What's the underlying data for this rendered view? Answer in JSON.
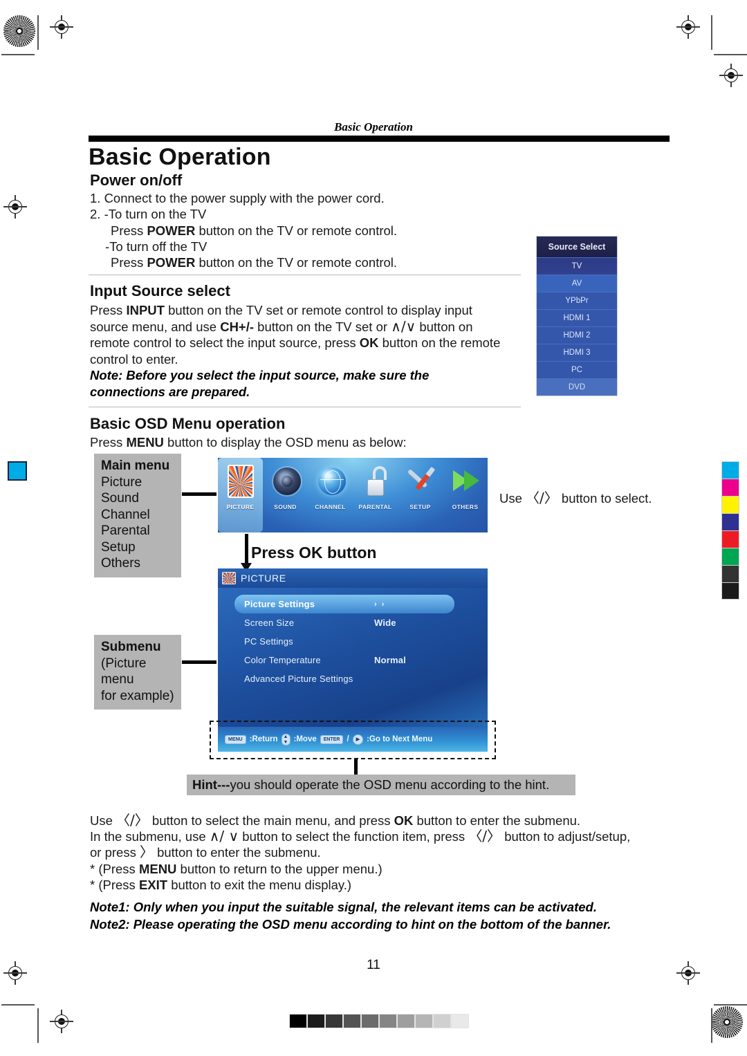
{
  "document": {
    "running_head": "Basic Operation",
    "chapter_title": "Basic Operation",
    "page_number": "11"
  },
  "power_section": {
    "heading": "Power on/off",
    "line1": "1. Connect to the power supply with the power cord.",
    "line2": "2. -To turn on the TV",
    "line3_pre": "Press ",
    "line3_bold": "POWER",
    "line3_post": " button on the TV or remote control.",
    "line4": "-To turn off the TV",
    "line5_pre": "Press ",
    "line5_bold": "POWER",
    "line5_post": " button on the TV or remote control."
  },
  "input_section": {
    "heading": "Input Source select",
    "p1_a": "Press ",
    "p1_b": "INPUT",
    "p1_c": " button on the TV set or remote control to display input source menu, and use ",
    "p1_d": "CH+/-",
    "p1_e": " button on the TV set or ",
    "p1_glyph": "∧/∨",
    "p1_f": " button on remote control to select the input source, press ",
    "p1_g": "OK",
    "p1_h": " button on the remote control to enter.",
    "note": "Note: Before you select the input source, make sure the connections are prepared."
  },
  "source_select": {
    "title": "Source Select",
    "items": [
      "TV",
      "AV",
      "YPbPr",
      "HDMI 1",
      "HDMI 2",
      "HDMI 3",
      "PC",
      "DVD"
    ],
    "selected": "TV"
  },
  "osd_section": {
    "heading": "Basic OSD Menu operation",
    "intro_a": "Press ",
    "intro_b": "MENU",
    "intro_c": " button to display the OSD menu as below:",
    "use_select_a": "Use ",
    "use_select_glyph": "〈/〉",
    "use_select_b": " button to select.",
    "press_ok": "Press OK button"
  },
  "main_menu_callout": {
    "title": "Main menu",
    "items": [
      "Picture",
      "Sound",
      "Channel",
      "Parental",
      "Setup",
      "Others"
    ]
  },
  "submenu_callout": {
    "title": "Submenu",
    "line1": "(Picture menu",
    "line2": "for example)"
  },
  "osd_main_menu": {
    "items": [
      {
        "label": "PICTURE",
        "icon": "picture-icon",
        "selected": true
      },
      {
        "label": "SOUND",
        "icon": "speaker-icon",
        "selected": false
      },
      {
        "label": "CHANNEL",
        "icon": "globe-icon",
        "selected": false
      },
      {
        "label": "PARENTAL",
        "icon": "lock-icon",
        "selected": false
      },
      {
        "label": "SETUP",
        "icon": "tools-icon",
        "selected": false
      },
      {
        "label": "OTHERS",
        "icon": "arrow-icon",
        "selected": false
      }
    ]
  },
  "osd_picture_menu": {
    "title": "PICTURE",
    "rows": [
      {
        "name": "Picture Settings",
        "value": "› ›",
        "highlighted": true
      },
      {
        "name": "Screen Size",
        "value": "Wide",
        "highlighted": false
      },
      {
        "name": "PC Settings",
        "value": "",
        "highlighted": false
      },
      {
        "name": "Color Temperature",
        "value": "Normal",
        "highlighted": false
      },
      {
        "name": "Advanced Picture Settings",
        "value": "",
        "highlighted": false
      }
    ],
    "hint_bar": {
      "menu_key": "MENU",
      "return_label": ":Return",
      "move_label": ":Move",
      "enter_key": "ENTER",
      "play_key": "▶",
      "next_label": ":Go to Next Menu"
    }
  },
  "hint_strip": {
    "bold": "Hint---",
    "rest": "you should operate the OSD menu according to the hint."
  },
  "instructions": {
    "l1_a": "Use ",
    "l1_glyph": "〈/〉",
    "l1_b": " button to select the main menu, and press ",
    "l1_bold": "OK",
    "l1_c": " button to enter the submenu.",
    "l2_a": "In the submenu, use ",
    "l2_glyph1": "∧/ ∨",
    "l2_b": " button to select the function item, press ",
    "l2_glyph2": "〈/〉",
    "l2_c": " button to adjust/setup,",
    "l3_a": "or press ",
    "l3_glyph": "〉",
    "l3_b": " button to enter the submenu.",
    "l4_a": "* (Press ",
    "l4_bold": "MENU",
    "l4_b": " button to return to the upper menu.)",
    "l5_a": "* (Press ",
    "l5_bold": "EXIT",
    "l5_b": " button to exit the menu display.)"
  },
  "notes": {
    "note1": "Note1: Only when you input the suitable signal, the relevant items can be activated.",
    "note2": "Note2: Please operating the OSD menu according to hint on the bottom of the banner."
  },
  "calibration": {
    "color_swatches": [
      "#00ACE8",
      "#EC008C",
      "#FFF200",
      "#2E3192",
      "#ED1C24",
      "#00A651",
      "#333333",
      "#1A1A1A"
    ],
    "gray_swatches": [
      "#000000",
      "#1c1c1c",
      "#383838",
      "#545454",
      "#6b6b6b",
      "#858585",
      "#9e9e9e",
      "#b5b5b5",
      "#d0d0d0",
      "#e9e9e9"
    ]
  }
}
